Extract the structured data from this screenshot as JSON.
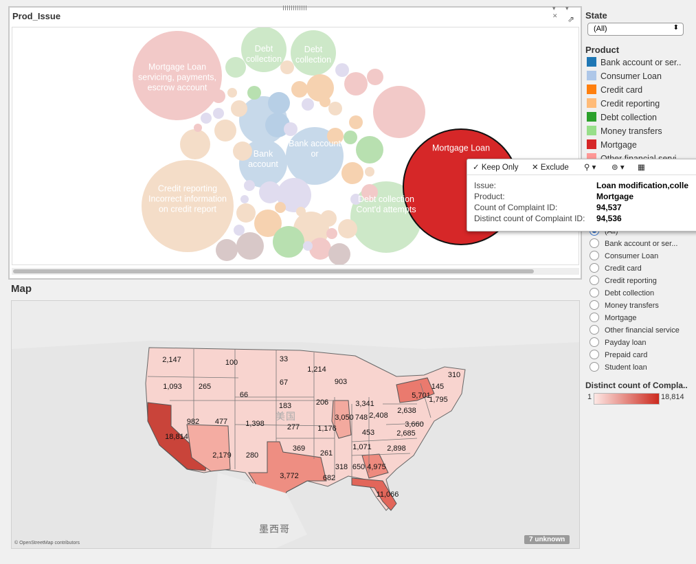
{
  "prod_panel": {
    "title": "Prod_Issue"
  },
  "bubbles_labeled": [
    {
      "label": "Mortgage Loan servicing, payments, escrow account"
    },
    {
      "label": "Debt collection"
    },
    {
      "label": "Debt collection"
    },
    {
      "label": "Bank account"
    },
    {
      "label": "Bank account or"
    },
    {
      "label": "Credit reporting Incorrect information on credit report"
    },
    {
      "label": "Debt collection Cont'd attempts"
    },
    {
      "label": "Mortgage Loan"
    }
  ],
  "map": {
    "title": "Map",
    "attribution": "© OpenStreetMap contributors",
    "unknown_badge": "7 unknown",
    "country_label": "美国",
    "mexico_label": "墨西哥",
    "state_values": [
      "2,147",
      "1,093",
      "100",
      "33",
      "1,214",
      "265",
      "67",
      "903",
      "3,341",
      "66",
      "310",
      "145",
      "5,701",
      "1,795",
      "183",
      "206",
      "2,638",
      "982",
      "477",
      "1,398",
      "277",
      "3,050",
      "748",
      "2,408",
      "3,660",
      "18,814",
      "1,176",
      "453",
      "2,685",
      "369",
      "1,071",
      "2,898",
      "2,179",
      "280",
      "261",
      "3,772",
      "318",
      "650",
      "4,975",
      "682",
      "11,066"
    ]
  },
  "filters": {
    "state_title": "State",
    "state_value": "(All)",
    "product_title": "Product",
    "product_legend": [
      {
        "label": "Bank account or ser..",
        "color": "#1f77b4"
      },
      {
        "label": "Consumer Loan",
        "color": "#aec7e8"
      },
      {
        "label": "Credit card",
        "color": "#ff7f0e"
      },
      {
        "label": "Credit reporting",
        "color": "#ffbb78"
      },
      {
        "label": "Debt collection",
        "color": "#2ca02c"
      },
      {
        "label": "Money transfers",
        "color": "#98df8a"
      },
      {
        "label": "Mortgage",
        "color": "#d62728"
      },
      {
        "label": "Other financial servi",
        "color": "#ff9896"
      }
    ],
    "product_radios": [
      "(All)",
      "Bank account or ser...",
      "Consumer Loan",
      "Credit card",
      "Credit reporting",
      "Debt collection",
      "Money transfers",
      "Mortgage",
      "Other financial service",
      "Payday loan",
      "Prepaid card",
      "Student loan"
    ],
    "distinct_title": "Distinct count of Compla..",
    "distinct_min": "1",
    "distinct_max": "18,814"
  },
  "tooltip": {
    "keep_only": "Keep Only",
    "exclude": "Exclude",
    "rows": [
      {
        "key": "Issue:",
        "value": "Loan modification,colle"
      },
      {
        "key": "Product:",
        "value": "Mortgage"
      },
      {
        "key": "Count of Complaint ID:",
        "value": "94,537"
      },
      {
        "key": "Distinct count of Complaint ID:",
        "value": "94,536"
      }
    ]
  }
}
